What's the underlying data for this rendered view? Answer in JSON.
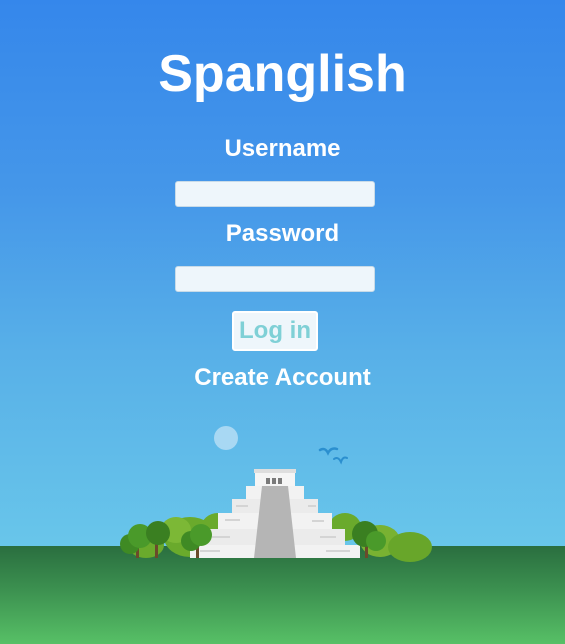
{
  "app": {
    "title": "Spanglish"
  },
  "login_form": {
    "username_label": "Username",
    "username_value": "",
    "password_label": "Password",
    "password_value": "",
    "login_button_label": "Log in",
    "create_account_link": "Create Account"
  },
  "colors": {
    "sky_top": "#3587eb",
    "sky_bottom": "#6ccbea",
    "grass": "#3c9150",
    "login_text": "#7fd0d6",
    "text": "#ffffff"
  },
  "illustration": {
    "subject": "stepped-pyramid-landscape",
    "icons": [
      "moon-icon",
      "bird-icon",
      "tree-icon",
      "pyramid-icon"
    ]
  }
}
